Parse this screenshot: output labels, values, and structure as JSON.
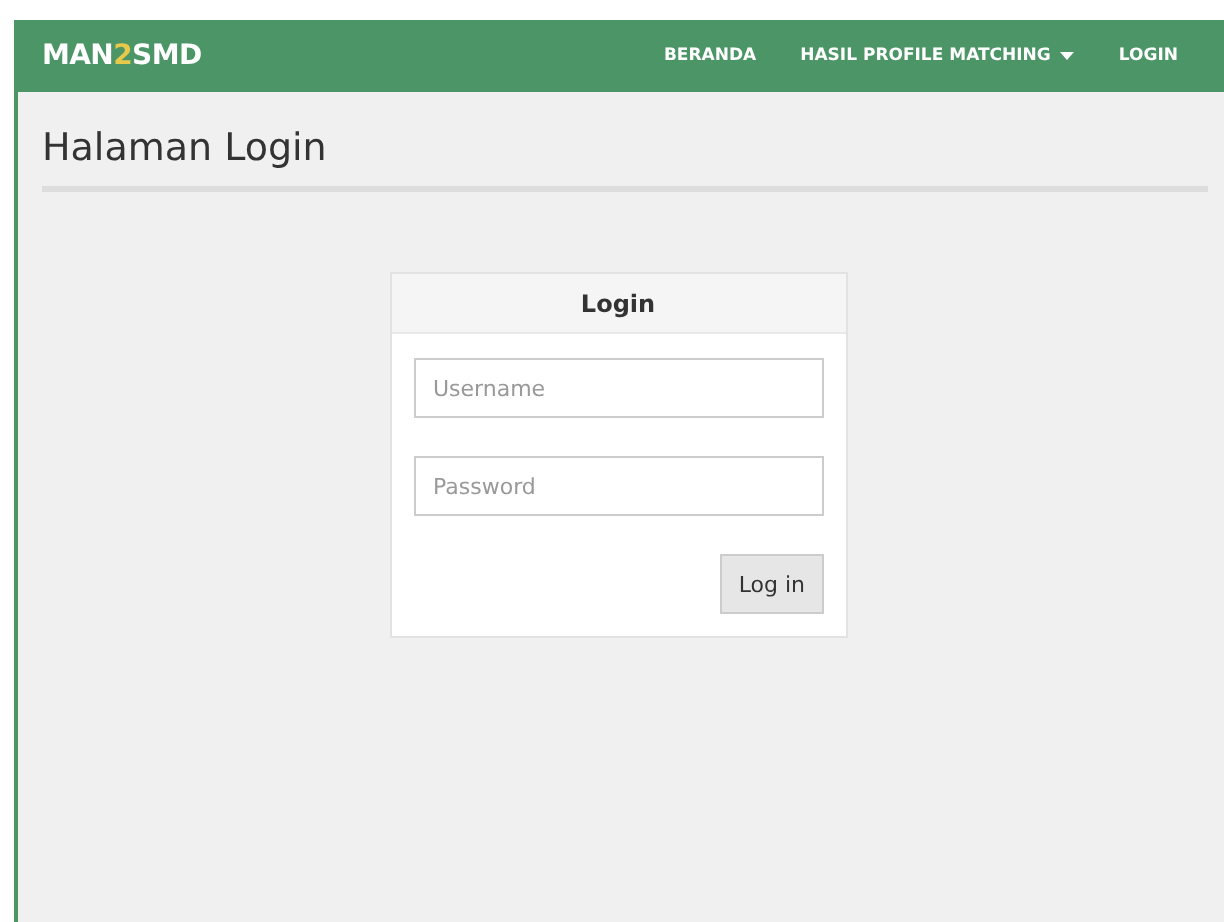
{
  "navbar": {
    "brand": [
      {
        "text": "MAN",
        "highlight": false
      },
      {
        "text": "2",
        "highlight": true
      },
      {
        "text": "SMD",
        "highlight": false
      }
    ],
    "items": [
      {
        "label": "BERANDA",
        "kind": "link"
      },
      {
        "label": "HASIL PROFILE MATCHING",
        "kind": "dropdown"
      },
      {
        "label": "LOGIN",
        "kind": "link"
      }
    ]
  },
  "page_title": "Halaman Login",
  "login_panel": {
    "title": "Login",
    "fields": [
      {
        "placeholder": "Username"
      },
      {
        "placeholder": "Password"
      }
    ],
    "button": "Log in"
  }
}
